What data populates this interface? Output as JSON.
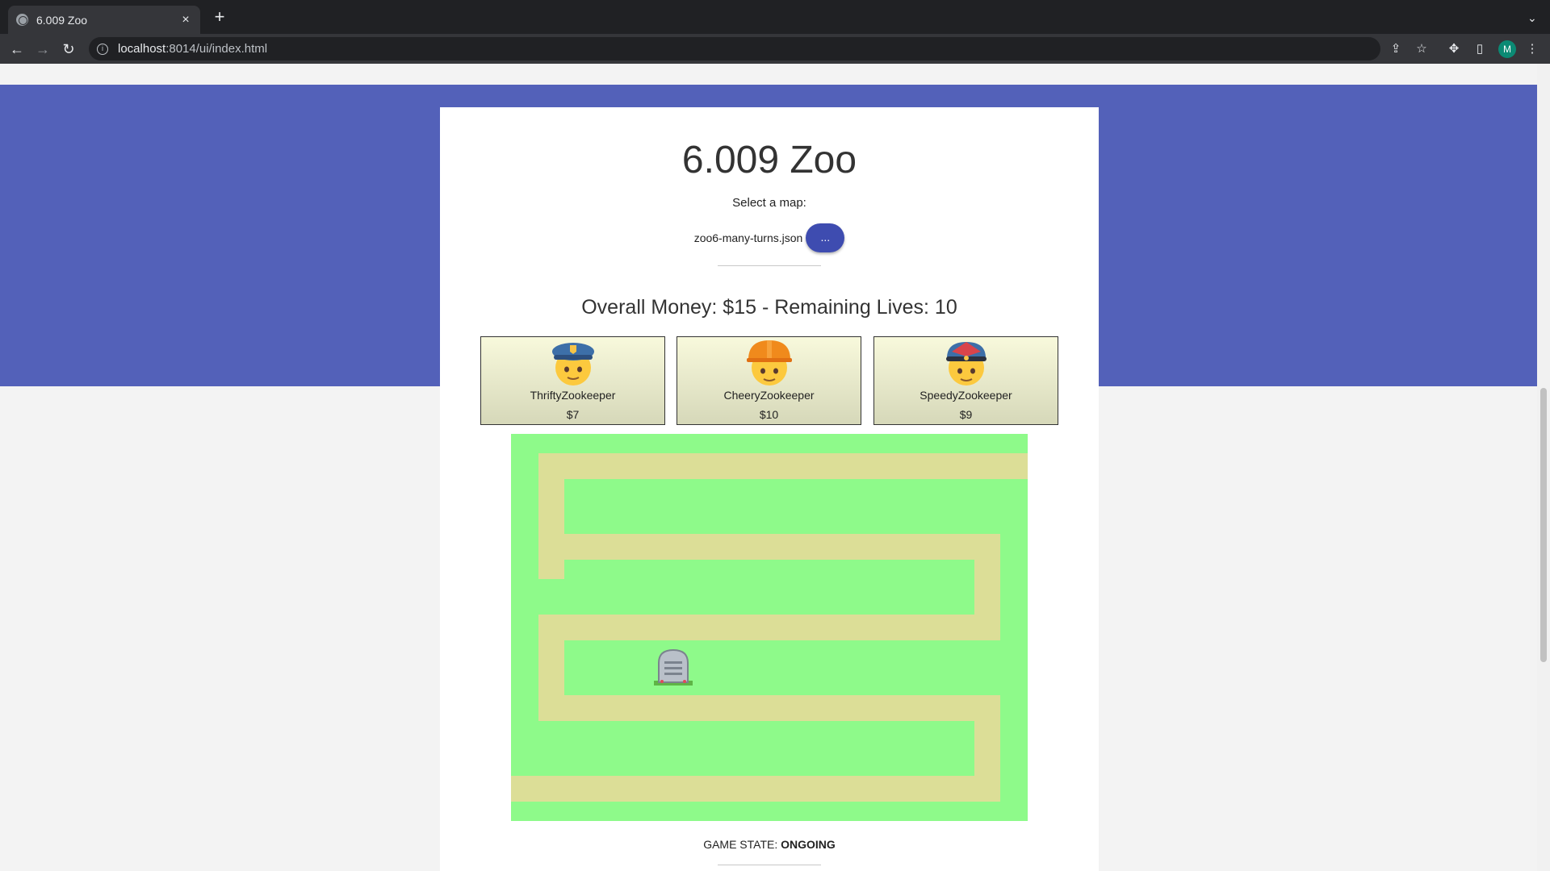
{
  "browser": {
    "tab_title": "6.009 Zoo",
    "url_host": "localhost",
    "url_rest": ":8014/ui/index.html",
    "profile_initial": "M"
  },
  "page": {
    "title": "6.009 Zoo",
    "select_label": "Select a map:",
    "map_name": "zoo6-many-turns.json",
    "map_button_label": "...",
    "status_line": "Overall Money: $15 - Remaining Lives: 10",
    "game_state_label": "GAME STATE:",
    "game_state_value": "ONGOING"
  },
  "zookeepers": [
    {
      "name": "ThriftyZookeeper",
      "cost": "$7",
      "icon": "police-officer-icon",
      "hat_color": "#3d6fa8"
    },
    {
      "name": "CheeryZookeeper",
      "cost": "$10",
      "icon": "construction-worker-icon",
      "hat_color": "#f08a1c"
    },
    {
      "name": "SpeedyZookeeper",
      "cost": "$9",
      "icon": "man-with-cap-icon",
      "hat_color": "#d9444b"
    }
  ],
  "board": {
    "grass_color": "#8efa8a",
    "path_color": "#dcde97",
    "entities": [
      {
        "icon": "headstone-icon"
      }
    ]
  },
  "colors": {
    "hero": "#5361b9",
    "accent_button": "#3e4cb0"
  }
}
